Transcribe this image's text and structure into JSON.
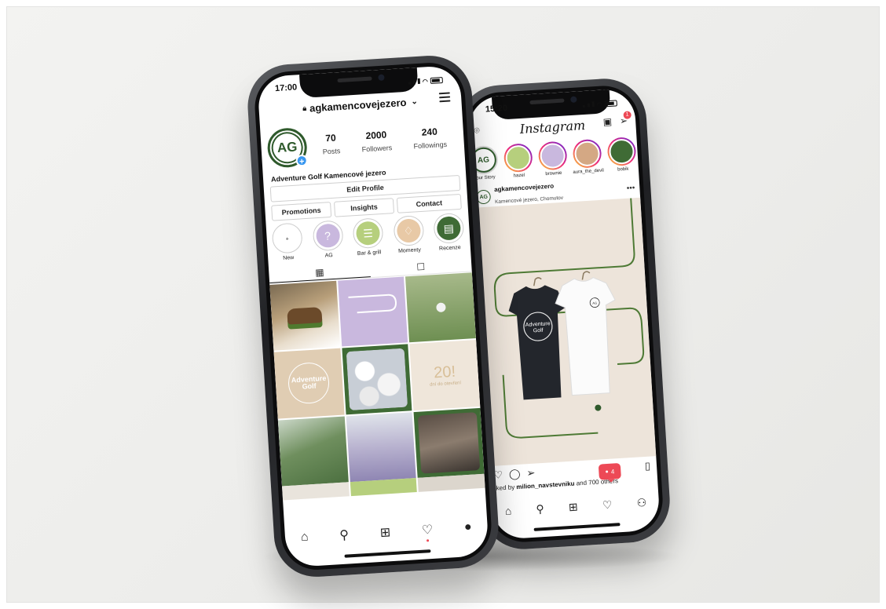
{
  "front": {
    "time": "17:00",
    "username": "agkamencovejezero",
    "avatar_text": "AG",
    "stats": [
      {
        "value": "70",
        "label": "Posts"
      },
      {
        "value": "2000",
        "label": "Followers"
      },
      {
        "value": "240",
        "label": "Followings"
      }
    ],
    "bio_name": "Adventure Golf Kamencové jezero",
    "buttons": {
      "edit_profile": "Edit Profile",
      "promotions": "Promotions",
      "insights": "Insights",
      "contact": "Contact"
    },
    "highlights": [
      {
        "label": "New",
        "color": "#ffffff",
        "icon": "plus-icon"
      },
      {
        "label": "AG",
        "color": "#c9b8de",
        "icon": "question-icon"
      },
      {
        "label": "Bar & grill",
        "color": "#b6cf7d",
        "icon": "burger-icon"
      },
      {
        "label": "Momenty",
        "color": "#e8c9a6",
        "icon": "drink-icon"
      },
      {
        "label": "Recenze",
        "color": "#3f6b35",
        "icon": "clipboard-icon"
      }
    ],
    "grid_text": {
      "logo_line1": "Adventure",
      "logo_line2": "Golf",
      "countdown": "20!",
      "countdown_sub": "dní do otevření"
    },
    "colors": {
      "accent_green": "#2f5a2c",
      "lavender": "#c9b8de",
      "sand": "#e0cdb3",
      "lime": "#b6cf7d",
      "blue_badge": "#3897f0"
    }
  },
  "back": {
    "time": "15:20",
    "app_name": "Instagram",
    "dm_badge": "1",
    "stories": [
      {
        "label": "Your Story",
        "color": "#ffffff"
      },
      {
        "label": "hazel",
        "color": "#b6cf7d"
      },
      {
        "label": "brownie",
        "color": "#c9b8de"
      },
      {
        "label": "aura_the_devil",
        "color": "#d4a884"
      },
      {
        "label": "bobik",
        "color": "#3f6b35"
      }
    ],
    "post": {
      "username": "agkamencovejezero",
      "location": "Kamencové jezero, Chomutov",
      "shirt_line1": "Adventure",
      "shirt_line2": "Golf",
      "shirt_small": "AG",
      "liked_prefix": "Liked by ",
      "liked_user": "milion_navstevniku",
      "liked_suffix": " and 700 others",
      "notification_count": "4"
    },
    "colors": {
      "post_bg": "#ede4da",
      "line_green": "#4e7a35"
    }
  }
}
